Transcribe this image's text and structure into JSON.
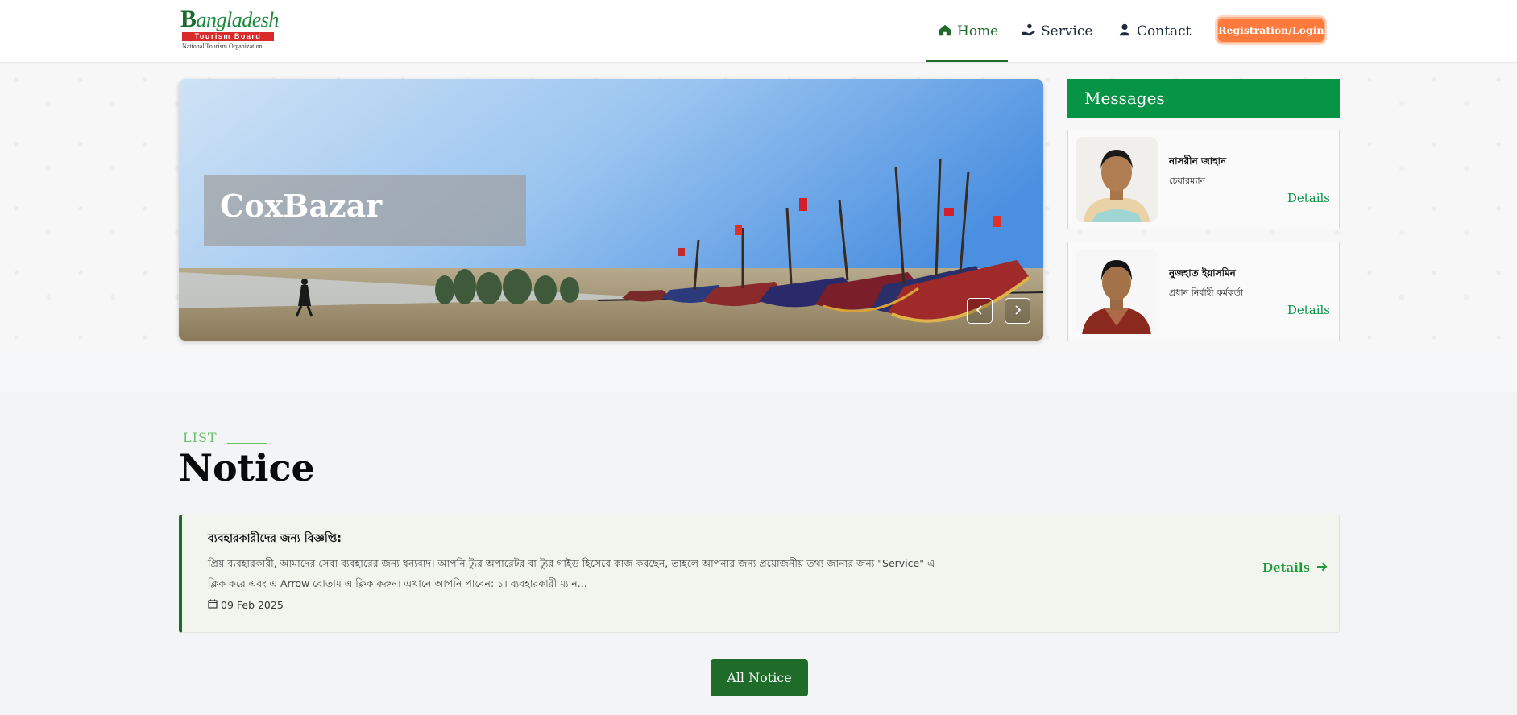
{
  "logo": {
    "word": "angladesh",
    "letter": "B",
    "board": "Tourism Board",
    "subtitle": "National Tourism Organization"
  },
  "nav": {
    "home": "Home",
    "service": "Service",
    "contact": "Contact",
    "login": "Registration/Login"
  },
  "slider": {
    "caption": "CoxBazar",
    "prev_icon": "chevron-left-icon",
    "next_icon": "chevron-right-icon"
  },
  "messages": {
    "heading": "Messages",
    "items": [
      {
        "name": "নাসরীন জাহান",
        "role": "চেয়ারম্যান",
        "details": "Details"
      },
      {
        "name": "নুজহাত ইয়াসমিন",
        "role": "প্রধান নির্বাহী কর্মকর্তা",
        "details": "Details"
      }
    ]
  },
  "notice": {
    "tag": "LIST",
    "title": "Notice",
    "items": [
      {
        "heading": "ব্যবহারকারীদের জন্য বিজ্ঞপ্তি:",
        "body": "প্রিয় ব্যবহারকারী, আমাদের সেবা ব্যবহারের জন্য ধন্যবাদ। আপনি ট্যুর অপারেটর বা ট্যুর গাইড হিসেবে কাজ করছেন, তাহলে আপনার জন্য প্রয়োজনীয় তথ্য জানার জন্য \"Service\" এ ক্লিক করে এবং এ Arrow বোতাম এ ক্লিক করুন। এখানে আপনি পাবেন: ১। ব্যবহারকারী ম্যান...",
        "date": "09 Feb 2025",
        "details": "Details"
      }
    ],
    "all_button": "All Notice"
  },
  "colors": {
    "brand_green": "#1f6b2a",
    "accent_green": "#079447",
    "login_orange": "#ff7a3d"
  }
}
